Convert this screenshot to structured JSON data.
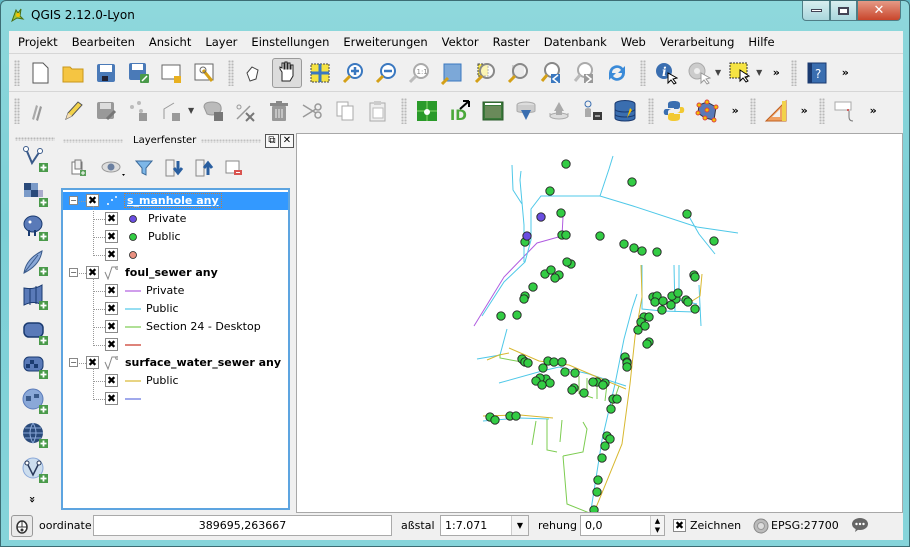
{
  "window": {
    "title": "QGIS 2.12.0-Lyon"
  },
  "menubar": [
    "Projekt",
    "Bearbeiten",
    "Ansicht",
    "Layer",
    "Einstellungen",
    "Erweiterungen",
    "Vektor",
    "Raster",
    "Datenbank",
    "Web",
    "Verarbeitung",
    "Hilfe"
  ],
  "toolbar1": [
    {
      "name": "new-project-icon"
    },
    {
      "name": "open-project-icon"
    },
    {
      "name": "save-project-icon"
    },
    {
      "name": "save-as-icon"
    },
    {
      "name": "new-print-composer-icon"
    },
    {
      "name": "composer-manager-icon"
    },
    {
      "name": "touch-zoom-icon"
    },
    {
      "name": "pan-hand-icon",
      "active": true
    },
    {
      "name": "pan-to-selection-icon"
    },
    {
      "name": "zoom-in-icon"
    },
    {
      "name": "zoom-out-icon"
    },
    {
      "name": "zoom-native-icon"
    },
    {
      "name": "zoom-full-icon"
    },
    {
      "name": "zoom-to-selection-icon"
    },
    {
      "name": "zoom-to-layer-icon"
    },
    {
      "name": "zoom-last-icon"
    },
    {
      "name": "zoom-next-icon"
    },
    {
      "name": "refresh-icon"
    },
    {
      "name": "identify-icon"
    },
    {
      "name": "run-action-icon"
    },
    {
      "name": "select-features-icon"
    }
  ],
  "toolbar2": [
    {
      "name": "current-edits-icon"
    },
    {
      "name": "toggle-editing-icon"
    },
    {
      "name": "save-edits-icon"
    },
    {
      "name": "add-feature-icon"
    },
    {
      "name": "add-line-feature-icon"
    },
    {
      "name": "move-feature-icon"
    },
    {
      "name": "node-tool-icon"
    },
    {
      "name": "delete-selected-icon"
    },
    {
      "name": "cut-features-icon"
    },
    {
      "name": "copy-features-icon"
    },
    {
      "name": "paste-features-icon"
    },
    {
      "name": "plugin-green-icon"
    },
    {
      "name": "id-plugin-icon"
    },
    {
      "name": "raster-image-icon"
    },
    {
      "name": "db-download-icon"
    },
    {
      "name": "db-upload-icon"
    },
    {
      "name": "postgis-export-icon"
    },
    {
      "name": "db-manager-icon"
    },
    {
      "name": "python-console-icon"
    },
    {
      "name": "polygon-plugin-icon"
    },
    {
      "name": "measure-icon"
    },
    {
      "name": "annotation-icon"
    }
  ],
  "sidebar": [
    "add-vector-layer-icon",
    "add-raster-layer-icon",
    "add-postgis-layer-icon",
    "add-spatialite-layer-icon",
    "add-mssql-layer-icon",
    "add-oracle-layer-icon",
    "add-db2-layer-icon",
    "add-wms-layer-icon",
    "add-wcs-layer-icon",
    "add-wfs-layer-icon"
  ],
  "layer_panel": {
    "title": "Layerfenster",
    "layers": [
      {
        "name": "s_manhole any",
        "selected": true,
        "geom": "point",
        "items": [
          {
            "label": "Private",
            "color": "#6a4ee0",
            "shape": "dot"
          },
          {
            "label": "Public",
            "color": "#33cc44",
            "shape": "dot"
          },
          {
            "label": "",
            "color": "#e89080",
            "shape": "dot"
          }
        ]
      },
      {
        "name": "foul_sewer any",
        "selected": false,
        "geom": "line",
        "items": [
          {
            "label": "Private",
            "color": "#b05ce0",
            "shape": "line"
          },
          {
            "label": "Public",
            "color": "#4fc8e8",
            "shape": "line"
          },
          {
            "label": "Section 24 - Desktop",
            "color": "#7ccc50",
            "shape": "line"
          },
          {
            "label": "",
            "color": "#c83020",
            "shape": "line"
          }
        ]
      },
      {
        "name": "surface_water_sewer any",
        "selected": false,
        "geom": "line",
        "items": [
          {
            "label": "Public",
            "color": "#d8b830",
            "shape": "line"
          },
          {
            "label": "",
            "color": "#6070e0",
            "shape": "line"
          }
        ]
      }
    ]
  },
  "statusbar": {
    "coord_label": "oordinate",
    "coord_value": "389695,263667",
    "scale_label": "aßstal",
    "scale_value": "1:7.071",
    "rotation_label": "rehung",
    "rotation_value": "0,0",
    "render_label": "Zeichnen",
    "crs": "EPSG:27700"
  },
  "colors": {
    "private_point": "#6a4ee0",
    "public_point": "#33cc44",
    "foul_private": "#b05ce0",
    "foul_public": "#4fc8e8",
    "section24": "#7ccc50",
    "sw_public": "#d8b830"
  }
}
